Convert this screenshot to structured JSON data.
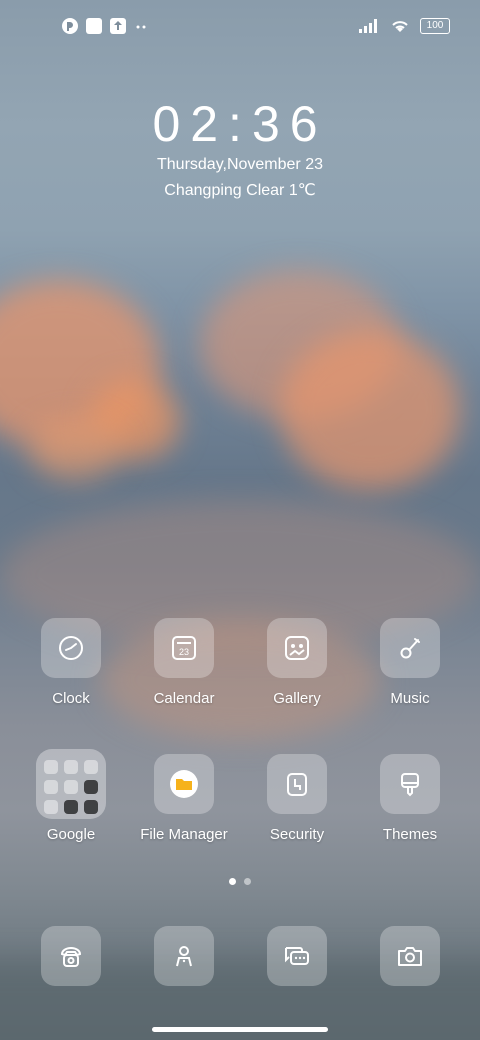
{
  "status_bar": {
    "battery": "100",
    "left_icons": [
      "app-notification-icon",
      "square-notification-icon",
      "upload-notification-icon",
      "more-notifications-icon"
    ],
    "right_icons": [
      "signal-icon",
      "wifi-icon",
      "battery-icon"
    ]
  },
  "lock_clock": {
    "time": "02:36",
    "date": "Thursday,November 23",
    "weather": "Changping Clear 1℃"
  },
  "apps": [
    {
      "label": "Clock",
      "icon": "clock-icon"
    },
    {
      "label": "Calendar",
      "icon": "calendar-icon",
      "badge": "23"
    },
    {
      "label": "Gallery",
      "icon": "gallery-icon"
    },
    {
      "label": "Music",
      "icon": "music-icon"
    },
    {
      "label": "Google",
      "icon": "google-folder-icon"
    },
    {
      "label": "File Manager",
      "icon": "folder-icon"
    },
    {
      "label": "Security",
      "icon": "security-icon"
    },
    {
      "label": "Themes",
      "icon": "themes-icon"
    }
  ],
  "dock": [
    {
      "icon": "phone-icon"
    },
    {
      "icon": "contacts-icon"
    },
    {
      "icon": "messages-icon"
    },
    {
      "icon": "camera-icon"
    }
  ],
  "pager": {
    "pages": 2,
    "active": 1
  },
  "colors": {
    "file_manager_accent": "#f6b21b",
    "text": "#ffffff"
  }
}
